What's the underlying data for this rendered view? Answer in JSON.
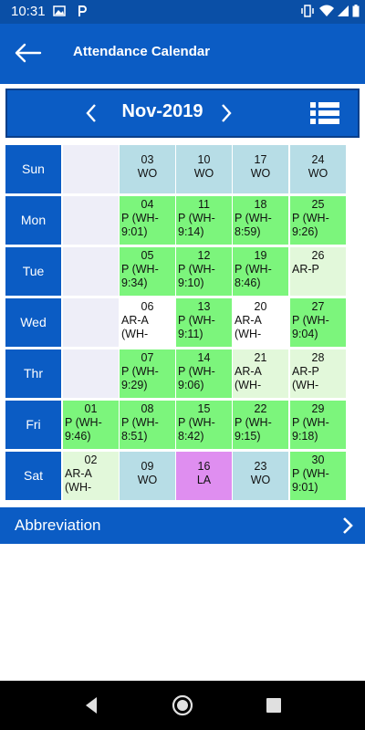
{
  "status": {
    "time": "10:31"
  },
  "appbar": {
    "title": "Attendance Calendar"
  },
  "calendar": {
    "month_label": "Nov-2019",
    "weekdays": [
      "Sun",
      "Mon",
      "Tue",
      "Wed",
      "Thr",
      "Fri",
      "Sat"
    ],
    "days": [
      {
        "row": 0,
        "col": 1,
        "date": "03",
        "status": "WO",
        "type": "wo"
      },
      {
        "row": 0,
        "col": 2,
        "date": "10",
        "status": "WO",
        "type": "wo"
      },
      {
        "row": 0,
        "col": 3,
        "date": "17",
        "status": "WO",
        "type": "wo"
      },
      {
        "row": 0,
        "col": 4,
        "date": "24",
        "status": "WO",
        "type": "wo"
      },
      {
        "row": 1,
        "col": 1,
        "date": "04",
        "status": "P (WH-9:01)",
        "type": "present"
      },
      {
        "row": 1,
        "col": 2,
        "date": "11",
        "status": "P (WH-9:14)",
        "type": "present"
      },
      {
        "row": 1,
        "col": 3,
        "date": "18",
        "status": "P (WH-8:59)",
        "type": "present"
      },
      {
        "row": 1,
        "col": 4,
        "date": "25",
        "status": "P (WH-9:26)",
        "type": "present"
      },
      {
        "row": 2,
        "col": 1,
        "date": "05",
        "status": "P (WH-9:34)",
        "type": "present"
      },
      {
        "row": 2,
        "col": 2,
        "date": "12",
        "status": "P (WH-9:10)",
        "type": "present"
      },
      {
        "row": 2,
        "col": 3,
        "date": "19",
        "status": "P (WH-8:46)",
        "type": "present"
      },
      {
        "row": 2,
        "col": 4,
        "date": "26",
        "status": "AR-P",
        "type": "ar"
      },
      {
        "row": 3,
        "col": 1,
        "date": "06",
        "status": "AR-A (WH-",
        "type": "white"
      },
      {
        "row": 3,
        "col": 2,
        "date": "13",
        "status": "P (WH-9:11)",
        "type": "present"
      },
      {
        "row": 3,
        "col": 3,
        "date": "20",
        "status": "AR-A (WH-",
        "type": "white"
      },
      {
        "row": 3,
        "col": 4,
        "date": "27",
        "status": "P (WH-9:04)",
        "type": "present"
      },
      {
        "row": 4,
        "col": 1,
        "date": "07",
        "status": "P (WH-9:29)",
        "type": "present"
      },
      {
        "row": 4,
        "col": 2,
        "date": "14",
        "status": "P (WH-9:06)",
        "type": "present"
      },
      {
        "row": 4,
        "col": 3,
        "date": "21",
        "status": "AR-A (WH-",
        "type": "ar"
      },
      {
        "row": 4,
        "col": 4,
        "date": "28",
        "status": "AR-P (WH-",
        "type": "ar"
      },
      {
        "row": 5,
        "col": 0,
        "date": "01",
        "status": "P (WH-9:46)",
        "type": "present"
      },
      {
        "row": 5,
        "col": 1,
        "date": "08",
        "status": "P (WH-8:51)",
        "type": "present"
      },
      {
        "row": 5,
        "col": 2,
        "date": "15",
        "status": "P (WH-8:42)",
        "type": "present"
      },
      {
        "row": 5,
        "col": 3,
        "date": "22",
        "status": "P (WH-9:15)",
        "type": "present"
      },
      {
        "row": 5,
        "col": 4,
        "date": "29",
        "status": "P (WH-9:18)",
        "type": "present"
      },
      {
        "row": 6,
        "col": 0,
        "date": "02",
        "status": "AR-A (WH-",
        "type": "ar"
      },
      {
        "row": 6,
        "col": 1,
        "date": "09",
        "status": "WO",
        "type": "wo"
      },
      {
        "row": 6,
        "col": 2,
        "date": "16",
        "status": "LA",
        "type": "leave"
      },
      {
        "row": 6,
        "col": 3,
        "date": "23",
        "status": "WO",
        "type": "wo"
      },
      {
        "row": 6,
        "col": 4,
        "date": "30",
        "status": "P (WH-9:01)",
        "type": "present"
      }
    ]
  },
  "abbreviation": {
    "label": "Abbreviation"
  },
  "colors": {
    "primary": "#0b5cc4",
    "present": "#7cf57c",
    "wo": "#b7dde6",
    "ar": "#e2f8da",
    "leave": "#df8ef0",
    "white": "#ffffff",
    "empty": "#eeeef8"
  }
}
